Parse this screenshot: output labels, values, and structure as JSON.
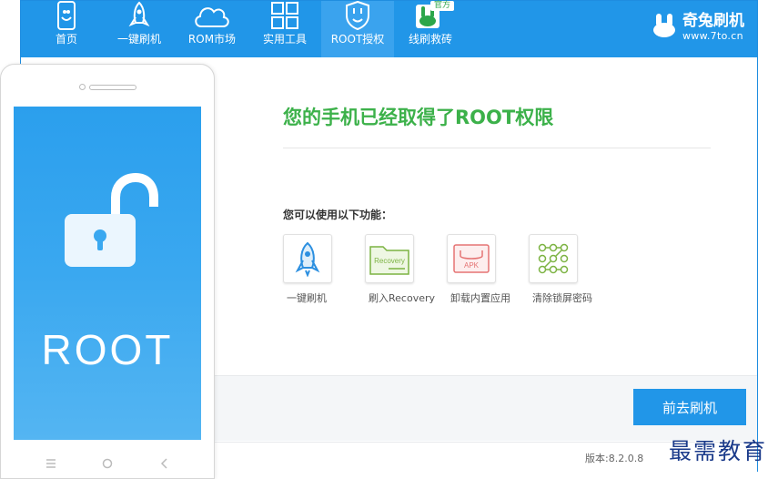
{
  "colors": {
    "accent": "#2196e8",
    "success": "#3cb14a",
    "nav_active": "#3aa3ee"
  },
  "nav": {
    "items": [
      {
        "label": "首页",
        "icon": "phone-rabbit-icon"
      },
      {
        "label": "一键刷机",
        "icon": "rocket-icon"
      },
      {
        "label": "ROM市场",
        "icon": "cloud-icon"
      },
      {
        "label": "实用工具",
        "icon": "grid-icon"
      },
      {
        "label": "ROOT授权",
        "icon": "shield-icon",
        "active": true
      },
      {
        "label": "线刷救砖",
        "icon": "rabbit-official-icon",
        "badge": "官方"
      }
    ]
  },
  "brand": {
    "name": "奇兔刷机",
    "url": "www.7to.cn"
  },
  "main": {
    "headline": "您的手机已经取得了ROOT权限",
    "features_title": "您可以使用以下功能：",
    "features": [
      {
        "label": "一键刷机",
        "icon": "rocket-icon"
      },
      {
        "label": "刷入Recovery",
        "icon": "folder-icon",
        "icon_text": "Recovery"
      },
      {
        "label": "卸载内置应用",
        "icon": "apk-box-icon",
        "icon_text": "APK"
      },
      {
        "label": "清除锁屏密码",
        "icon": "pattern-lock-icon"
      }
    ],
    "go_button": "前去刷机"
  },
  "footer": {
    "version": "版本:8.2.0.8"
  },
  "phone": {
    "screen_text": "ROOT"
  },
  "watermark": "最需教育"
}
